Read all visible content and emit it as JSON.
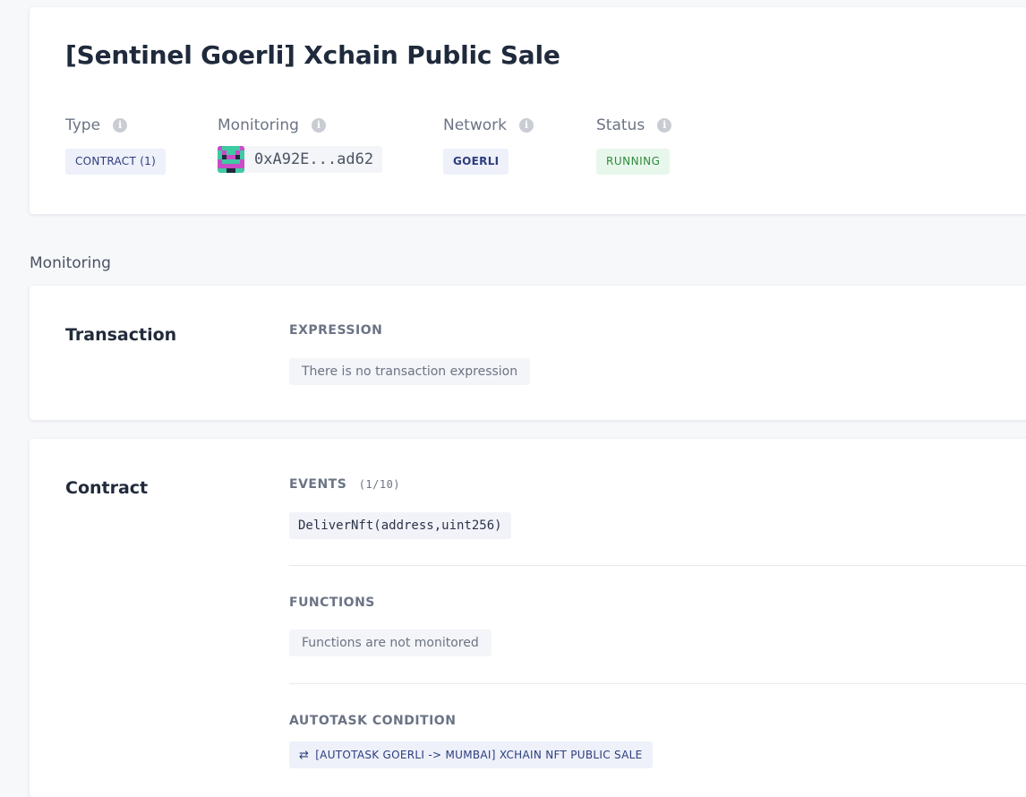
{
  "header": {
    "title": "[Sentinel Goerli] Xchain Public Sale",
    "info_icon": "i",
    "type": {
      "label": "Type",
      "value": "CONTRACT (1)"
    },
    "monitoring": {
      "label": "Monitoring",
      "address": "0xA92E...ad62"
    },
    "network": {
      "label": "Network",
      "value": "GOERLI"
    },
    "status": {
      "label": "Status",
      "value": "RUNNING"
    }
  },
  "section_heading": "Monitoring",
  "transaction": {
    "title": "Transaction",
    "expression_label": "EXPRESSION",
    "expression_value": "There is no transaction expression"
  },
  "contract": {
    "title": "Contract",
    "events_label": "EVENTS",
    "events_count": "(1/10)",
    "events": [
      "DeliverNft(address,uint256)"
    ],
    "functions_label": "FUNCTIONS",
    "functions_value": "Functions are not monitored",
    "autotask_label": "AUTOTASK CONDITION",
    "autotask_icon": "⇄",
    "autotask_value": "[AUTOTASK GOERLI -> MUMBAI] XCHAIN NFT PUBLIC SALE"
  },
  "colors": {
    "accent": "#2c3e7c",
    "status_running_bg": "#e8f7eb",
    "status_running_text": "#2f8a3c",
    "badge_bg": "#eef0fa"
  },
  "icons": {
    "info": "info-icon",
    "avatar": "identicon-avatar",
    "autotask": "swap-arrows-icon"
  }
}
